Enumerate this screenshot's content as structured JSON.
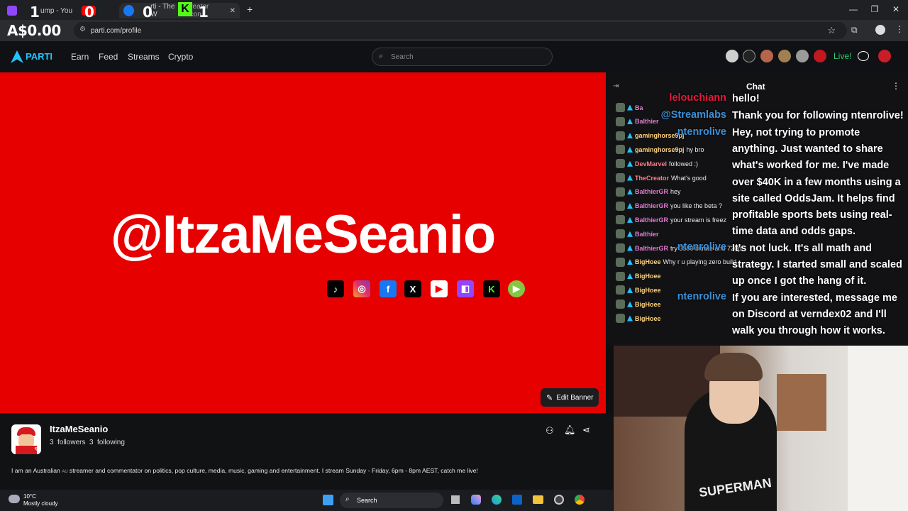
{
  "browser": {
    "tabs": [
      {
        "label": "ump - You"
      },
      {
        "label": "rti - The W",
        "label2": "Creator Econ"
      }
    ],
    "url": "parti.com/profile",
    "overlay_balance": "A$0.00",
    "overlay_counts": [
      "1",
      "0",
      "0",
      "1"
    ]
  },
  "site": {
    "logo": "PARTI",
    "nav": [
      "Earn",
      "Feed",
      "Streams",
      "Crypto"
    ],
    "search_placeholder": "Search",
    "live_label": "Live!"
  },
  "banner": {
    "handle": "@ItzaMeSeanio",
    "edit_label": "Edit Banner",
    "socials": [
      "tiktok",
      "instagram",
      "facebook",
      "x",
      "youtube",
      "twitch",
      "kick",
      "rumble"
    ]
  },
  "profile": {
    "name": "ItzaMeSeanio",
    "followers": "3",
    "followers_label": "followers",
    "following": "3",
    "following_label": "following",
    "bio_pre": "I am an Australian",
    "bio_tag": "AU",
    "bio_post": "streamer and commentator on politics, pop culture, media, music, gaming and entertainment. I stream Sunday - Friday, 6pm - 8pm AEST, catch me live!"
  },
  "chat": {
    "title": "Chat",
    "rows": [
      {
        "user": "Ba",
        "text": "",
        "color": "#e07bd0"
      },
      {
        "user": "Balthier",
        "text": "",
        "color": "#e07bd0"
      },
      {
        "user": "gaminghorse9pj",
        "text": "",
        "color": "#ffd27a"
      },
      {
        "user": "gaminghorse9pj",
        "text": "hy bro",
        "color": "#ffd27a"
      },
      {
        "user": "DevMarvel",
        "text": "followed :)",
        "color": "#ff7a8a"
      },
      {
        "user": "TheCreator",
        "text": "What's good",
        "color": "#ff7a8a"
      },
      {
        "user": "BalthierGR",
        "text": "hey",
        "color": "#e07bd0"
      },
      {
        "user": "BalthierGR",
        "text": "you like the beta ?",
        "color": "#e07bd0"
      },
      {
        "user": "BalthierGR",
        "text": "your stream is freez",
        "color": "#e07bd0"
      },
      {
        "user": "Balthier",
        "text": "",
        "color": "#e07bd0"
      },
      {
        "user": "BalthierGR",
        "text": "try 3500 bitrate and 720p",
        "color": "#e07bd0"
      },
      {
        "user": "BigHoee",
        "text": "Why r u playing zero build",
        "color": "#ffd27a"
      },
      {
        "user": "BigHoee",
        "text": "",
        "color": "#ffd27a"
      },
      {
        "user": "BigHoee",
        "text": "",
        "color": "#ffd27a"
      },
      {
        "user": "BigHoee",
        "text": "",
        "color": "#ffd27a"
      },
      {
        "user": "BigHoee",
        "text": "",
        "color": "#ffd27a"
      }
    ],
    "overlay_names": [
      {
        "name": "lelouchiann",
        "color": "#e8173a"
      },
      {
        "name": "@Streamlabs",
        "color": "#3d8fd6"
      },
      {
        "name": "ntenrolive",
        "color": "#3d8fd6"
      },
      {
        "name": "ntenrolive",
        "color": "#3d8fd6"
      },
      {
        "name": "ntenrolive",
        "color": "#3d8fd6"
      }
    ],
    "overlay_lines": [
      "hello!",
      "Thank you for following ntenrolive!",
      "Hey, not trying to promote",
      "anything. Just wanted to share",
      "what's worked for me. I've made",
      "over $40K in a few months using a",
      "site called OddsJam. It helps find",
      "profitable sports bets using real-",
      "time data and odds gaps.",
      "It's not luck. It's all math and",
      "strategy. I started small and scaled",
      "up once I got the hang of it.",
      "If you are interested, message me",
      "on Discord at verndex02 and I'll",
      "walk you through how it works."
    ]
  },
  "webcam": {
    "shirt_text": "SUPERMAN"
  },
  "taskbar": {
    "temp": "10°C",
    "weather": "Mostly cloudy",
    "search": "Search"
  },
  "colors": {
    "brand": "#23c3ff",
    "banner": "#e60000",
    "live": "#2ecc71"
  }
}
